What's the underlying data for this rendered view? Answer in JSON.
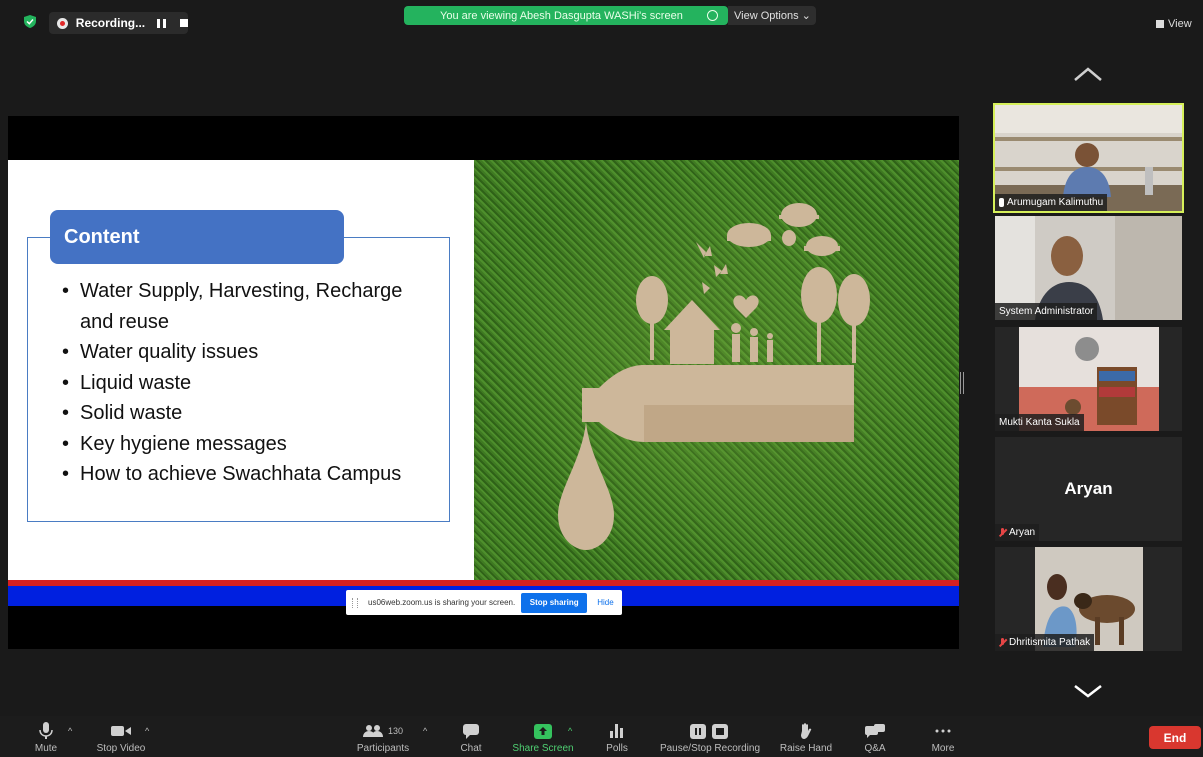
{
  "top_bar": {
    "recording_label": "Recording...",
    "viewing_banner": "You are viewing Abesh Dasgupta WASHi's screen",
    "view_options": "View Options ⌄",
    "view_label": "View"
  },
  "slide": {
    "title": "Content",
    "bullets": [
      "Water Supply, Harvesting, Recharge and reuse",
      "Water quality issues",
      "Liquid waste",
      "Solid waste",
      "Key hygiene messages",
      "How to achieve Swachhata Campus"
    ]
  },
  "share_notice": {
    "text": "us06web.zoom.us is sharing your screen.",
    "stop_label": "Stop sharing",
    "hide_label": "Hide"
  },
  "participants_gallery": [
    {
      "name": "Arumugam Kalimuthu",
      "speaking": true,
      "muted": false
    },
    {
      "name": "System Administrator",
      "speaking": false,
      "muted": false
    },
    {
      "name": "Mukti Kanta Sukla",
      "speaking": false,
      "muted": false
    },
    {
      "name": "Aryan",
      "display_text": "Aryan",
      "speaking": false,
      "muted": true
    },
    {
      "name": "Dhritismita Pathak",
      "speaking": false,
      "muted": true
    }
  ],
  "toolbar": {
    "mute": "Mute",
    "stop_video": "Stop Video",
    "participants": "Participants",
    "participant_count": "130",
    "chat": "Chat",
    "share_screen": "Share Screen",
    "polls": "Polls",
    "pause_stop_recording": "Pause/Stop Recording",
    "raise_hand": "Raise Hand",
    "qa": "Q&A",
    "more": "More",
    "end": "End"
  },
  "colors": {
    "banner_green": "#24b35e",
    "slide_title_blue": "#4472c4",
    "end_red": "#d9372f",
    "active_speaker": "#d6f05a",
    "share_green": "#4fcf72"
  }
}
